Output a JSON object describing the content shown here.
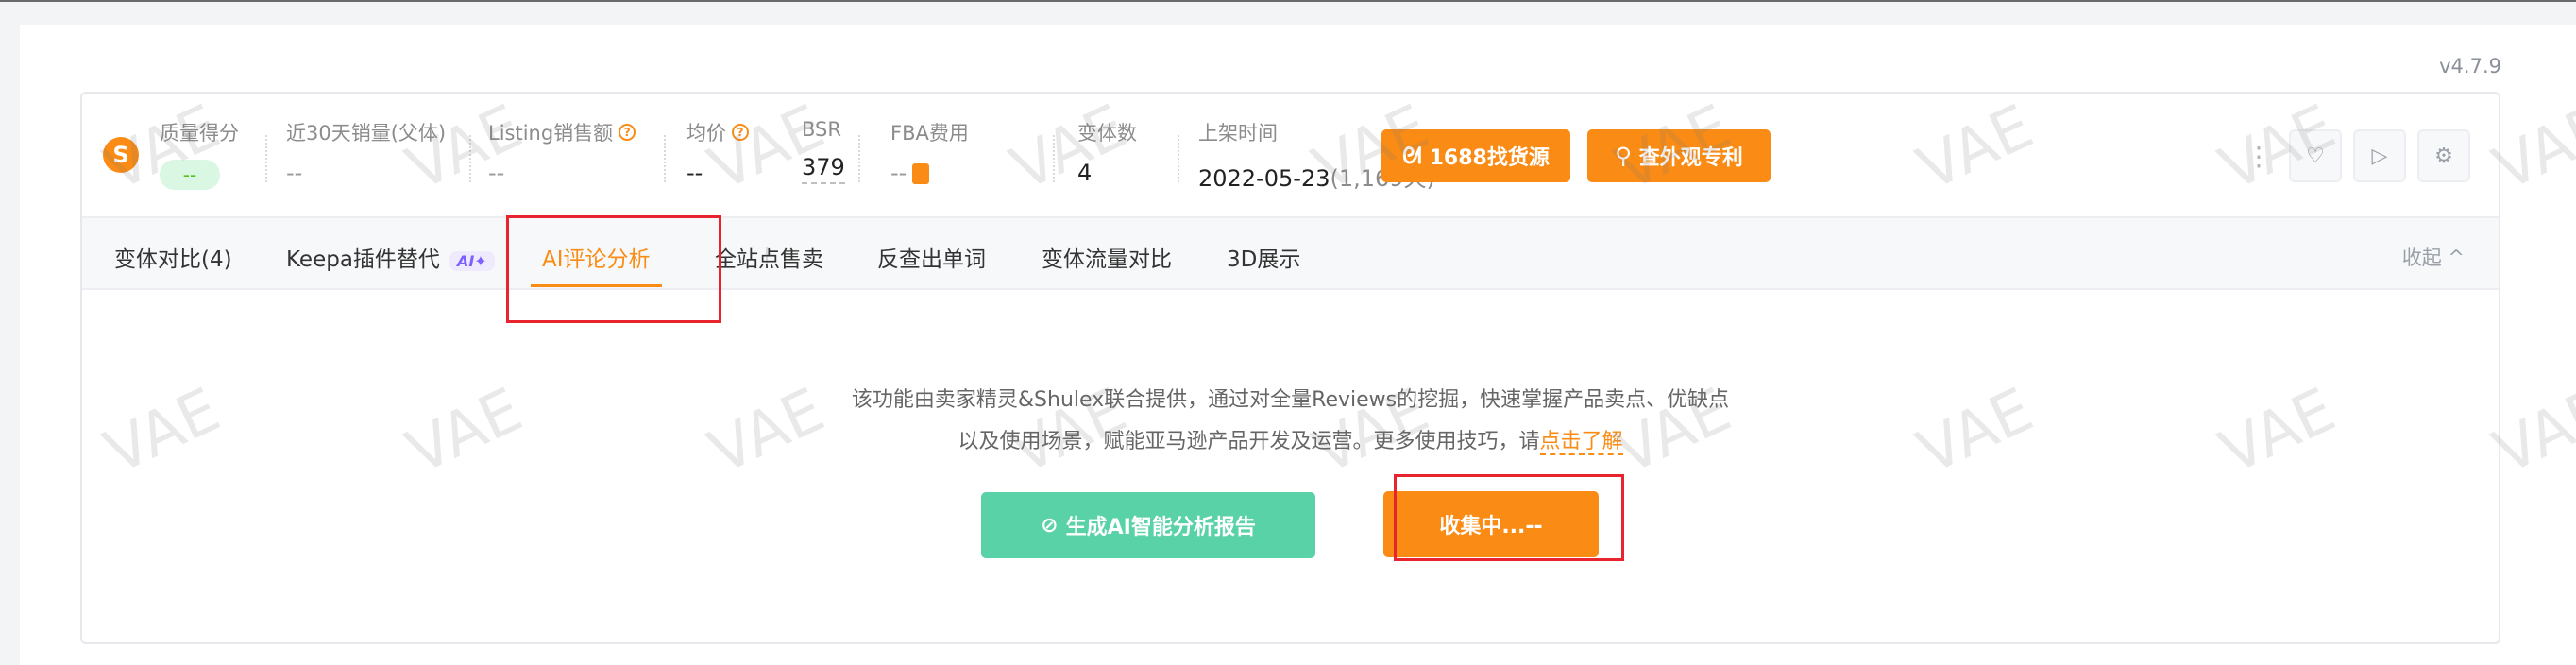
{
  "version": "v4.7.9",
  "stats": {
    "logo": "S",
    "quality_label": "质量得分",
    "quality_value": "--",
    "sales30_label": "近30天销量(父体)",
    "sales30_value": "--",
    "listing_label": "Listing销售额",
    "listing_value": "--",
    "avgprice_label": "均价",
    "avgprice_value": "--",
    "bsr_label": "BSR",
    "bsr_value": "379",
    "fba_label": "FBA费用",
    "fba_value": "--",
    "variants_label": "变体数",
    "variants_value": "4",
    "listed_label": "上架时间",
    "listed_date": "2022-05-23",
    "listed_days": "(1,169天)"
  },
  "buttons": {
    "source_1688": "1688找货源",
    "patent": "查外观专利",
    "generate_report": "生成AI智能分析报告",
    "collecting": "收集中...--"
  },
  "icons": {
    "source_icon": "ᘛ",
    "patent_icon": "⚲",
    "link_icon": "⊘",
    "dots": "⋮",
    "heart": "♡",
    "play": "▷",
    "gear": "⚙"
  },
  "tabs": [
    {
      "label": "变体对比(4)"
    },
    {
      "label": "Keepa插件替代",
      "badge": "AI✦"
    },
    {
      "label": "AI评论分析"
    },
    {
      "label": "全站点售卖"
    },
    {
      "label": "反查出单词"
    },
    {
      "label": "变体流量对比"
    },
    {
      "label": "3D展示"
    }
  ],
  "collapse_label": "收起 ^",
  "description": {
    "line1": "该功能由卖家精灵&Shulex联合提供，通过对全量Reviews的挖掘，快速掌握产品卖点、优缺点",
    "line2_prefix": "以及使用场景，赋能亚马逊产品开发及运营。更多使用技巧，请",
    "line2_link": "点击了解"
  },
  "watermark": "VAE",
  "colors": {
    "accent": "#fa8c16",
    "green": "#5ad2a8",
    "highlight": "#e8252f"
  }
}
